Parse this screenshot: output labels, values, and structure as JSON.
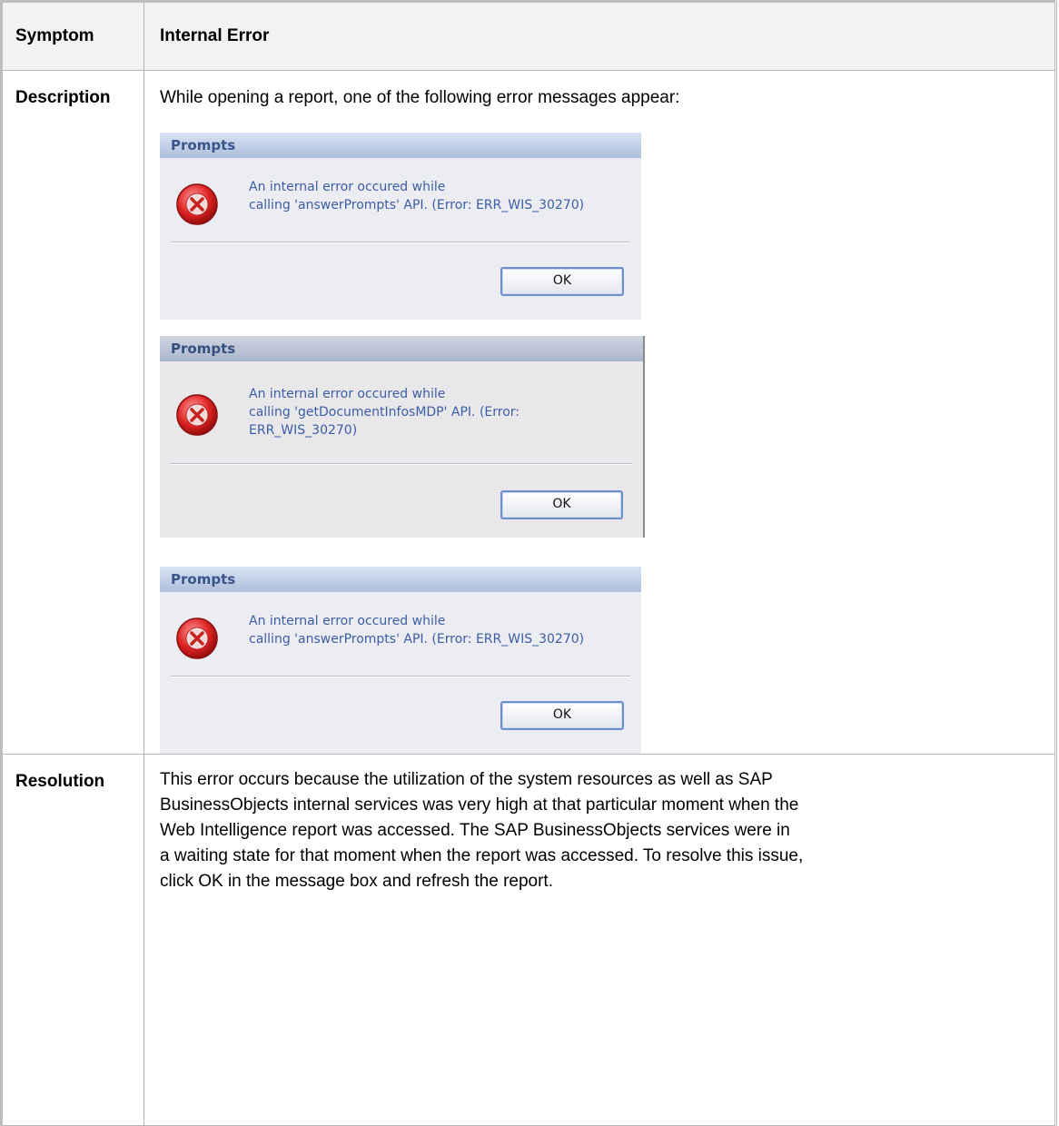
{
  "header": {
    "symptom_label": "Symptom",
    "symptom_value": "Internal Error"
  },
  "description": {
    "label": "Description",
    "text": "While opening a report, one of the following error messages appear:",
    "dialogs": [
      {
        "title": "Prompts",
        "line1": "An internal error occured while",
        "line2": "calling 'answerPrompts' API. (Error: ERR_WIS_30270)",
        "line3": "",
        "ok_label": "OK"
      },
      {
        "title": "Prompts",
        "line1": "An internal error occured while",
        "line2": "calling 'getDocumentInfosMDP' API. (Error:",
        "line3": "ERR_WIS_30270)",
        "ok_label": "OK"
      },
      {
        "title": "Prompts",
        "line1": "An internal error occured while",
        "line2": "calling 'answerPrompts' API. (Error: ERR_WIS_30270)",
        "line3": "",
        "ok_label": "OK"
      }
    ]
  },
  "resolution": {
    "label": "Resolution",
    "line1": "This error occurs because the utilization of the system resources as well as SAP",
    "line2": "BusinessObjects internal services was very high at that particular moment when the",
    "line3": "Web Intelligence report was accessed. The SAP BusinessObjects services were in",
    "line4": "a waiting state for that moment when the report was accessed. To resolve this issue,",
    "line5": "click OK in the message box and refresh the report."
  },
  "icons": {
    "error": "error-x-icon"
  }
}
